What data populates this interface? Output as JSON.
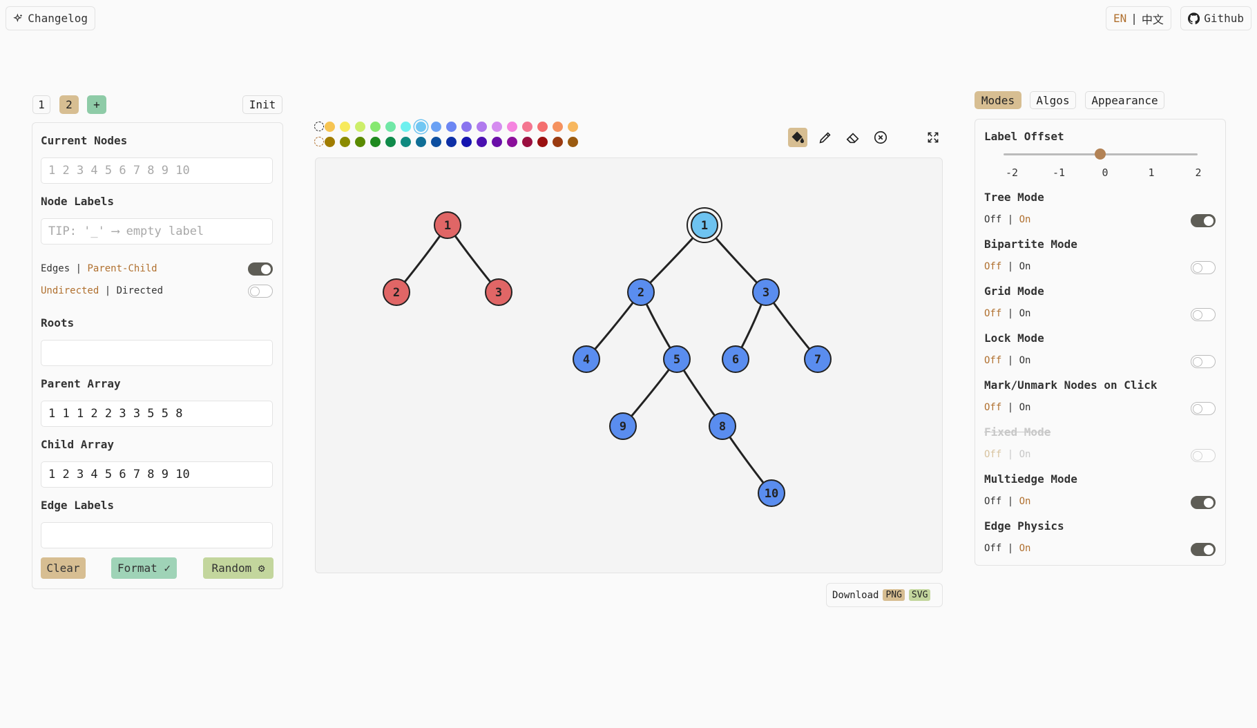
{
  "header": {
    "changelog_label": "Changelog",
    "lang_en": "EN",
    "lang_sep": "|",
    "lang_zh": "中文",
    "github_label": "Github"
  },
  "graph_tabs": {
    "tabs": [
      "1",
      "2"
    ],
    "add_label": "+",
    "init_label": "Init"
  },
  "left_panel": {
    "current_nodes_title": "Current Nodes",
    "current_nodes_placeholder": "1 2 3 4 5 6 7 8 9 10",
    "node_labels_title": "Node Labels",
    "node_labels_placeholder": "TIP: '_' ⟶ empty label",
    "edges_label": "Edges",
    "edges_sep": "|",
    "edges_mode": "Parent-Child",
    "undirected_label": "Undirected",
    "directed_sep": "|",
    "directed_label": "Directed",
    "roots_title": "Roots",
    "roots_value": "",
    "parent_array_title": "Parent Array",
    "parent_array_value": "1 1 1 2 2 3 3 5 5 8",
    "child_array_title": "Child Array",
    "child_array_value": "1 2 3 4 5 6 7 8 9 10",
    "edge_labels_title": "Edge Labels",
    "edge_labels_value": "",
    "clear_label": "Clear",
    "format_label": "Format ✓",
    "random_label": "Random ⚙"
  },
  "palette": {
    "light": [
      "#f6c452",
      "#f7ea5c",
      "#cdee6a",
      "#86e870",
      "#70e7a6",
      "#6ef0ef",
      "#71c7f3",
      "#6aa1f4",
      "#6c86f3",
      "#8a74ef",
      "#b07aee",
      "#d58cf0",
      "#f584df",
      "#f47690",
      "#f46f6f",
      "#f5925f",
      "#f7b75e"
    ],
    "dark": [
      "#a07c00",
      "#8a8a00",
      "#5a8a00",
      "#1f8a1f",
      "#0f8a4a",
      "#108a80",
      "#0f6e96",
      "#0d4fa0",
      "#0d2fa6",
      "#1515b0",
      "#4a10b0",
      "#6a0fa8",
      "#8a0f9a",
      "#9a0f3f",
      "#9a1010",
      "#9a3a10",
      "#9a5a10"
    ],
    "selected_index": 6
  },
  "canvas": {
    "download_label": "Download",
    "png_label": "PNG",
    "svg_label": "SVG"
  },
  "graph": {
    "node_colors": {
      "red": "#e06666",
      "blue": "#5a8def",
      "highlight": "#6ec3f0"
    },
    "nodes": [
      {
        "label": "1",
        "color": "red"
      },
      {
        "label": "2",
        "color": "red"
      },
      {
        "label": "3",
        "color": "red"
      },
      {
        "label": "1",
        "color": "highlight"
      },
      {
        "label": "2",
        "color": "blue"
      },
      {
        "label": "3",
        "color": "blue"
      },
      {
        "label": "4",
        "color": "blue"
      },
      {
        "label": "5",
        "color": "blue"
      },
      {
        "label": "6",
        "color": "blue"
      },
      {
        "label": "7",
        "color": "blue"
      },
      {
        "label": "9",
        "color": "blue"
      },
      {
        "label": "8",
        "color": "blue"
      },
      {
        "label": "10",
        "color": "blue"
      }
    ]
  },
  "right_panel": {
    "tabs": [
      "Modes",
      "Algos",
      "Appearance"
    ],
    "active_tab": "Modes",
    "label_offset_title": "Label Offset",
    "slider_ticks": [
      "-2",
      "-1",
      "0",
      "1",
      "2"
    ],
    "slider_value": 0,
    "off_label": "Off",
    "sep": "|",
    "on_label": "On",
    "modes": [
      {
        "name": "Tree Mode",
        "on": true,
        "disabled": false
      },
      {
        "name": "Bipartite Mode",
        "on": false,
        "disabled": false
      },
      {
        "name": "Grid Mode",
        "on": false,
        "disabled": false
      },
      {
        "name": "Lock Mode",
        "on": false,
        "disabled": false
      },
      {
        "name": "Mark/Unmark Nodes on Click",
        "on": false,
        "disabled": false
      },
      {
        "name": "Fixed Mode",
        "on": false,
        "disabled": true
      },
      {
        "name": "Multiedge Mode",
        "on": true,
        "disabled": false
      },
      {
        "name": "Edge Physics",
        "on": true,
        "disabled": false
      }
    ]
  }
}
